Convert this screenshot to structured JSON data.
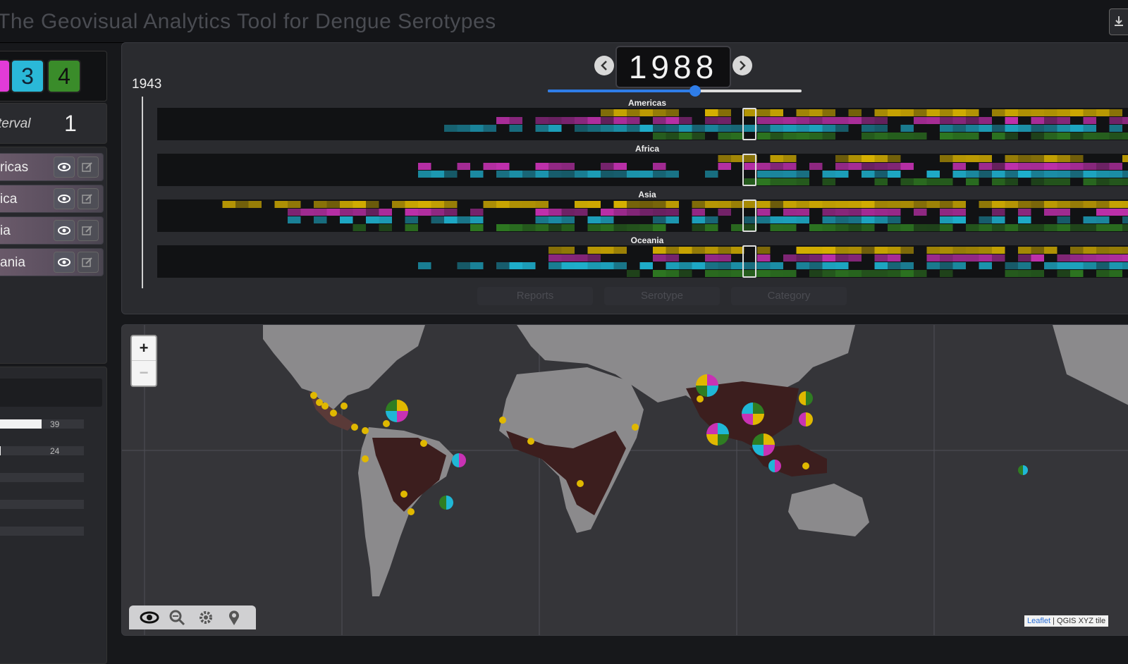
{
  "header": {
    "title": "The Geovisual Analytics Tool for Dengue Serotypes"
  },
  "sidebar": {
    "serotypes": [
      {
        "label": "",
        "color": "#e23bd8"
      },
      {
        "label": "3",
        "color": "#2ab8d8"
      },
      {
        "label": "4",
        "color": "#3a8c2a"
      }
    ],
    "interval_label": "terval",
    "interval_value": "1",
    "regions": [
      {
        "label": "ricas"
      },
      {
        "label": "ica"
      },
      {
        "label": "ia"
      },
      {
        "label": "ania"
      }
    ],
    "stats": [
      {
        "value": "39",
        "fraction": 1.0
      },
      {
        "value": "24",
        "fraction": 0.1
      }
    ]
  },
  "timeline": {
    "start_year": "1943",
    "current_year": "1988",
    "slider_fraction": 0.58,
    "rows": [
      {
        "title": "Americas"
      },
      {
        "title": "Africa"
      },
      {
        "title": "Asia"
      },
      {
        "title": "Oceania"
      }
    ],
    "tabs": [
      "Reports",
      "Serotype",
      "Category"
    ]
  },
  "map": {
    "zoom_in": "+",
    "zoom_out": "−",
    "attribution_leaflet": "Leaflet",
    "attribution_rest": "| QGIS XYZ tile"
  },
  "colors": {
    "serotype1": "#e0b800",
    "serotype2": "#c832b4",
    "serotype3": "#1fb7d6",
    "serotype4": "#2f7d22",
    "accent": "#2f7de8"
  }
}
